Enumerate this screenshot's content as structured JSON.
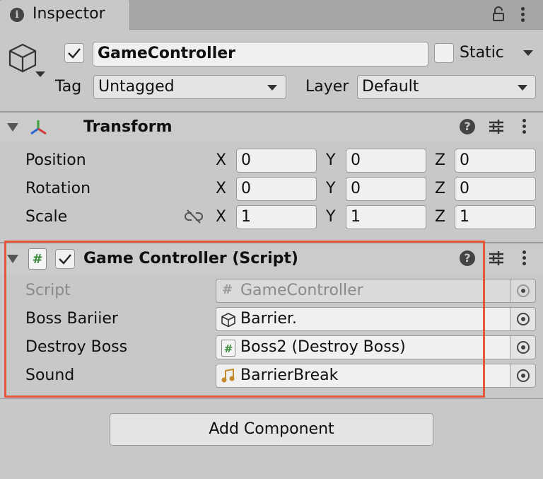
{
  "tab": {
    "title": "Inspector"
  },
  "object": {
    "name": "GameController",
    "static_label": "Static",
    "tag_label": "Tag",
    "tag_value": "Untagged",
    "layer_label": "Layer",
    "layer_value": "Default",
    "active": true,
    "is_static": false
  },
  "transform": {
    "title": "Transform",
    "rows": [
      {
        "label": "Position",
        "x": "0",
        "y": "0",
        "z": "0"
      },
      {
        "label": "Rotation",
        "x": "0",
        "y": "0",
        "z": "0"
      },
      {
        "label": "Scale",
        "x": "1",
        "y": "1",
        "z": "1"
      }
    ],
    "axis": {
      "x": "X",
      "y": "Y",
      "z": "Z"
    }
  },
  "script_component": {
    "title": "Game Controller (Script)",
    "enabled": true,
    "hash_glyph": "#",
    "fields": [
      {
        "label": "Script",
        "value": "GameController",
        "icon": "script-icon"
      },
      {
        "label": "Boss Bariier",
        "value": "Barrier.",
        "icon": "gameobject-icon"
      },
      {
        "label": "Destroy Boss",
        "value": "Boss2 (Destroy Boss)",
        "icon": "script-icon"
      },
      {
        "label": "Sound",
        "value": "BarrierBreak",
        "icon": "audio-clip-icon"
      }
    ]
  },
  "add_component_label": "Add Component",
  "colors": {
    "highlight": "#e4573d",
    "script_green": "#3a8a3a",
    "audio_gold": "#c28a2a"
  }
}
